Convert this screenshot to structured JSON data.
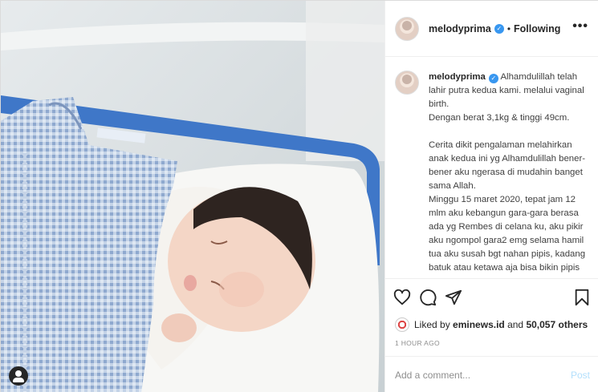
{
  "post": {
    "username": "melodyprima",
    "follow_status": "Following",
    "separator": "•",
    "more_label": "•••"
  },
  "caption": {
    "username": "melodyprima",
    "lines": [
      "Alhamdulillah telah lahir putra kedua kami. melalui vaginal birth.",
      "Dengan berat 3,1kg & tinggi 49cm.",
      "",
      "Cerita dikit pengalaman melahirkan anak kedua ini yg Alhamdulillah bener-bener aku ngerasa di mudahin banget sama Allah.",
      "Minggu 15 maret 2020, tepat jam 12 mlm aku kebangun gara-gara berasa ada yg Rembes di celana ku, aku pikir aku ngompol gara2 emg selama hamil tua aku susah bgt nahan pipis, kadang batuk atau ketawa aja bisa bikin pipis"
    ]
  },
  "likes": {
    "prefix": "Liked by",
    "liker": "eminews.id",
    "connector": "and",
    "others": "50,057 others"
  },
  "timestamp": "1 HOUR AGO",
  "comment": {
    "placeholder": "Add a comment...",
    "post_label": "Post"
  },
  "icons": [
    "heart-icon",
    "comment-icon",
    "share-icon",
    "bookmark-icon",
    "more-icon",
    "verified-icon",
    "user-tag-icon"
  ],
  "colors": {
    "verified": "#3897f0",
    "post_disabled": "#b2dffc",
    "muted": "#8e8e8e",
    "border": "#efefef"
  }
}
